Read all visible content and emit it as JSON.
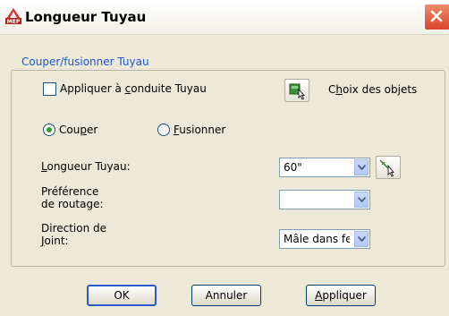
{
  "window": {
    "title": "Longueur Tuyau",
    "icon_label": "MEP",
    "close_icon": "close-icon",
    "accent_color": "#1a55d4"
  },
  "group": {
    "legend": "Couper/fusionner Tuyau",
    "apply_checkbox": {
      "pre": "Appliquer à ",
      "mnemonic": "c",
      "post": "onduite Tuyau",
      "checked": false
    },
    "select_objects": {
      "pre": "C",
      "mnemonic": "h",
      "post": "oix des objets"
    },
    "radio_cut": {
      "pre": "Cou",
      "mnemonic": "p",
      "post": "er",
      "selected": true
    },
    "radio_merge": {
      "pre": "",
      "mnemonic": "F",
      "post": "usionner",
      "selected": false
    },
    "length": {
      "pre": "",
      "mnemonic": "L",
      "post": "ongueur Tuyau:",
      "value": "60\""
    },
    "routing": {
      "line1": "Préférence",
      "line2": "de routage:",
      "value": ""
    },
    "joint": {
      "line1": "Direction de",
      "line2_pre": "",
      "line2_mnemonic": "J",
      "line2_post": "oint:",
      "value": "Mâle dans femelle"
    }
  },
  "buttons": {
    "ok": "OK",
    "cancel": "Annuler",
    "apply": {
      "pre": "",
      "mnemonic": "A",
      "post": "ppliquer"
    }
  }
}
